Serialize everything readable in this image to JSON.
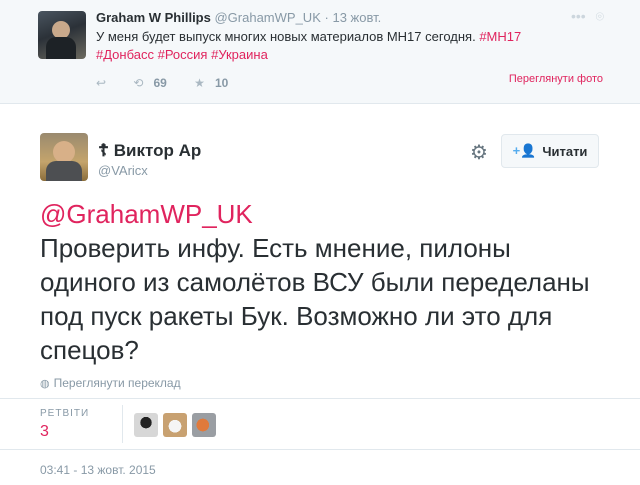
{
  "parent_tweet": {
    "name": "Graham W Phillips",
    "handle": "@GrahamWP_UK",
    "date": "13 жовт.",
    "text": "У меня будет выпуск многих новых материалов МН17 сегодня.",
    "hashtags": [
      "#МН17",
      "#Донбасс",
      "#Россия",
      "#Украина"
    ],
    "view_photo_label": "Переглянути фото",
    "retweets": "69",
    "likes": "10",
    "icons": [
      "reply-icon",
      "retweet-icon",
      "like-icon",
      "more-icon",
      "location-icon"
    ]
  },
  "tweet": {
    "author_mark": "☦",
    "name": "Виктор Ар",
    "handle": "@VAricx",
    "follow_label": "Читати",
    "mention": "@GrahamWP_UK",
    "text": "Проверить инфу. Есть мнение, пилоны одиного из самолётов ВСУ были переделаны под пуск ракеты Бук. Возможно ли это для спецов?",
    "translate_label": "Переглянути переклад",
    "retweets_label": "РЕТВІТИ",
    "retweets_count": "3",
    "timestamp": "03:41 - 13 жовт. 2015"
  },
  "colors": {
    "accent": "#e0245e",
    "link_blue": "#55acee",
    "muted": "#8899a6",
    "text": "#292f33"
  }
}
